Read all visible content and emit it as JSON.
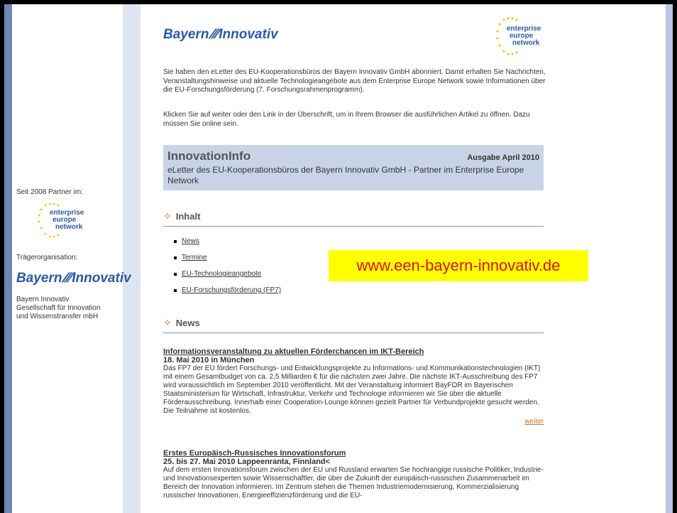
{
  "sidebar": {
    "partner_label": "Seit 2008 Partner im:",
    "trager_label": "Trägerorganisation:",
    "org_lines": [
      "Bayern Innovativ",
      "Gesellschaft für Innovation",
      "und Wissenstransfer mbH"
    ]
  },
  "logos": {
    "bayern_left": "Bayern",
    "bayern_right": "Innovativ",
    "een_lines": [
      "enterprise",
      "europe",
      "network"
    ]
  },
  "intro": {
    "paragraph1": "Sie haben den eLetter des EU-Kooperationsbüros der Bayern Innovativ GmbH abonniert. Damit erhalten Sie Nachrichten, Veranstaltungshinweise und aktuelle Technologieangebote aus dem Enterprise Europe Network sowie Informationen über die EU-Forschungsförderung (7. Forschungsrahmenprogramm).",
    "paragraph2": "Klicken Sie auf weiter oder den Link in der Überschrift, um in Ihrem Browser die ausführlichen Artikel zu öffnen. Dazu müssen Sie online sein."
  },
  "banner": {
    "title": "InnovationInfo",
    "issue": "Ausgabe April 2010",
    "subtitle": "eLetter des EU-Kooperationsbüros der Bayern Innovativ GmbH - Partner im Enterprise Europe Network"
  },
  "sections": {
    "contents_heading": "Inhalt",
    "news_heading": "News"
  },
  "toc": [
    "News",
    "Termine",
    "EU-Technologieangebote",
    "EU-Forschungsförderung (FP7)"
  ],
  "overlay_url": "www.een-bayern-innovativ.de",
  "articles": [
    {
      "title": "Informationsveranstaltung zu aktuellen Förderchancen im IKT-Bereich",
      "date": "18. Mai 2010 in München",
      "body": "Das FP7 der EU fördert Forschungs- und Entwicklungsprojekte zu Informations- und Kommunikationstechnologien (IKT) mit einem Gesamtbudget von ca. 2,5 Milliarden € für die nächsten zwei Jahre. Die nächste IKT-Ausschreibung des FP7 wird voraussichtlich im September 2010 veröffentlicht. Mit der Veranstaltung informiert BayFOR im Bayerischen Staatsministerium für Wirtschaft, Infrastruktur, Verkehr und Technologie informieren wir Sie über die aktuelle Förderausschreibung. Innerhalb einer Cooperation-Lounge können gezielt Partner für Verbundprojekte gesucht werden. Die Teilnahme ist kostenlos.",
      "more": "weiter"
    },
    {
      "title": "Erstes Europäisch-Russisches Innovationsforum",
      "date": "25. bis 27. Mai 2010 Lappeenranta, Finnland<",
      "body": "Auf dem ersten Innovationsforum zwischen der EU und Russland erwarten Sie hochrangige russische Politiker, Industrie- und Innovationsexperten sowie Wissenschaftler, die über die Zukunft der europäisch-russischen Zusammenarbeit im Bereich der Innovation informieren. Im Zentrum stehen die Themen Industriemodernisierung, Kommerzialisierung russischer Innovationen, Energieeffizienzförderung und die EU-"
    }
  ],
  "colors": {
    "accent_orange": "#e06a1a",
    "logo_blue": "#2a5aa8",
    "banner_bg": "#c8d4e6",
    "overlay_bg": "#ffff00",
    "overlay_text": "#e01010"
  }
}
